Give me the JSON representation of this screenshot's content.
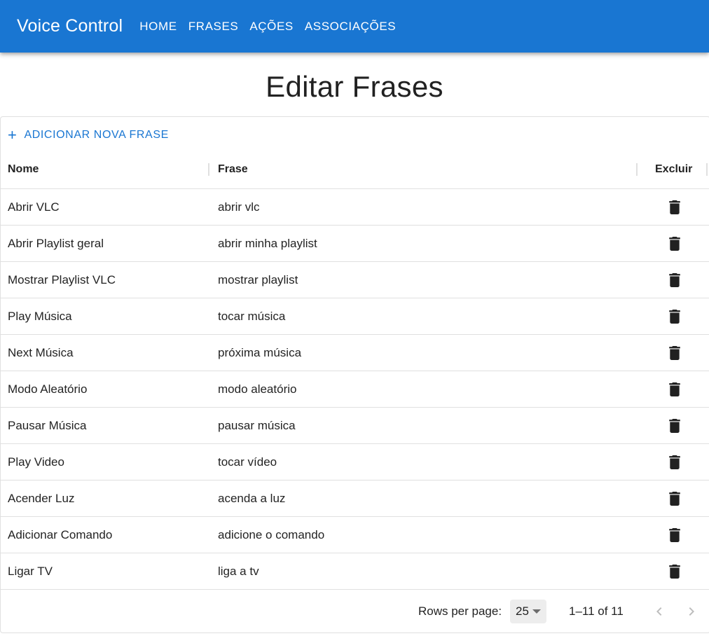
{
  "app": {
    "brand": "Voice Control",
    "nav": [
      "HOME",
      "FRASES",
      "AÇÕES",
      "ASSOCIAÇÕES"
    ],
    "accent_color": "#1976d2"
  },
  "page": {
    "title": "Editar Frases"
  },
  "toolbar": {
    "add_icon": "plus-icon",
    "add_label": "ADICIONAR NOVA FRASE"
  },
  "table": {
    "columns": [
      "Nome",
      "Frase",
      "Excluir"
    ],
    "delete_icon": "trash-icon",
    "rows": [
      {
        "nome": "Abrir VLC",
        "frase": "abrir vlc"
      },
      {
        "nome": "Abrir Playlist geral",
        "frase": "abrir minha playlist"
      },
      {
        "nome": "Mostrar Playlist VLC",
        "frase": "mostrar playlist"
      },
      {
        "nome": "Play Música",
        "frase": "tocar música"
      },
      {
        "nome": "Next Música",
        "frase": "próxima música"
      },
      {
        "nome": "Modo Aleatório",
        "frase": "modo aleatório"
      },
      {
        "nome": "Pausar Música",
        "frase": "pausar música"
      },
      {
        "nome": "Play Video",
        "frase": "tocar vídeo"
      },
      {
        "nome": "Acender Luz",
        "frase": "acenda a luz"
      },
      {
        "nome": "Adicionar Comando",
        "frase": "adicione o comando"
      },
      {
        "nome": "Ligar TV",
        "frase": "liga a tv"
      }
    ]
  },
  "pagination": {
    "rows_per_page_label": "Rows per page:",
    "rows_per_page_value": "25",
    "range_label": "1–11 of 11",
    "prev_icon": "chevron-left-icon",
    "next_icon": "chevron-right-icon"
  }
}
